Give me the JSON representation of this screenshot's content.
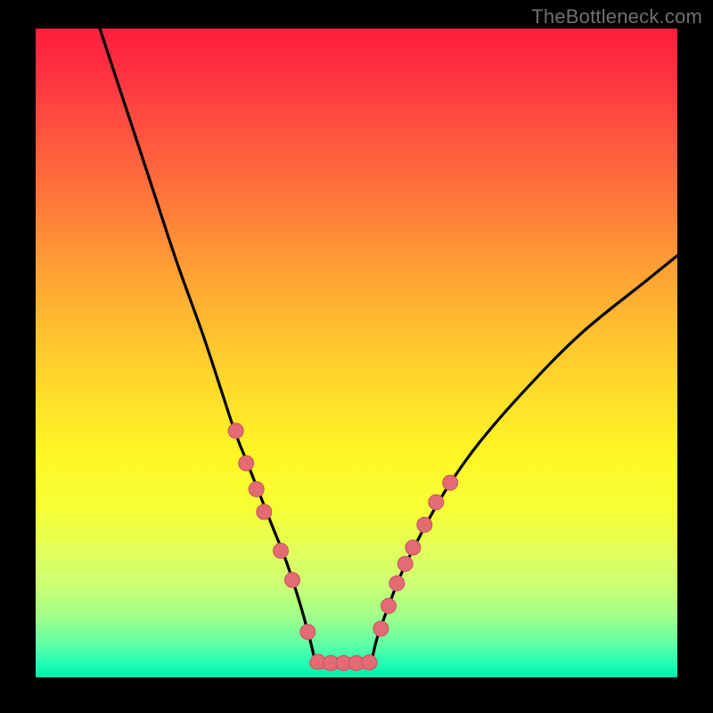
{
  "watermark": {
    "text": "TheBottleneck.com"
  },
  "chart_data": {
    "type": "line",
    "title": "",
    "xlabel": "",
    "ylabel": "",
    "xlim": [
      0,
      100
    ],
    "ylim": [
      0,
      100
    ],
    "series": [
      {
        "name": "left-curve",
        "x": [
          10,
          14,
          18,
          22,
          26,
          29,
          31,
          33,
          35,
          37,
          39,
          41,
          42.7,
          43.6
        ],
        "y": [
          100,
          88,
          76,
          64,
          53,
          44,
          38,
          33,
          28,
          23,
          18,
          12,
          6,
          2.2
        ]
      },
      {
        "name": "right-curve",
        "x": [
          52.3,
          53.2,
          55,
          57,
          60,
          64,
          69,
          76,
          85,
          95,
          100
        ],
        "y": [
          2.2,
          6,
          11,
          16,
          22,
          29,
          36,
          44,
          53,
          61,
          65
        ]
      },
      {
        "name": "flat-bottom",
        "x": [
          43.6,
          52.3
        ],
        "y": [
          2.2,
          2.2
        ]
      }
    ],
    "markers": {
      "name": "highlight-markers",
      "color": "#e46a73",
      "points": [
        {
          "x": 31.2,
          "y": 38.0
        },
        {
          "x": 32.8,
          "y": 33.0
        },
        {
          "x": 34.4,
          "y": 29.0
        },
        {
          "x": 35.6,
          "y": 25.5
        },
        {
          "x": 38.2,
          "y": 19.5
        },
        {
          "x": 40.0,
          "y": 15.0
        },
        {
          "x": 42.4,
          "y": 7.0
        },
        {
          "x": 44.0,
          "y": 2.4
        },
        {
          "x": 46.0,
          "y": 2.2
        },
        {
          "x": 48.0,
          "y": 2.2
        },
        {
          "x": 50.0,
          "y": 2.2
        },
        {
          "x": 52.0,
          "y": 2.3
        },
        {
          "x": 53.8,
          "y": 7.5
        },
        {
          "x": 55.0,
          "y": 11.0
        },
        {
          "x": 56.3,
          "y": 14.5
        },
        {
          "x": 57.6,
          "y": 17.5
        },
        {
          "x": 58.8,
          "y": 20.0
        },
        {
          "x": 60.6,
          "y": 23.5
        },
        {
          "x": 62.4,
          "y": 27.0
        },
        {
          "x": 64.6,
          "y": 30.0
        }
      ]
    },
    "colors": {
      "curve": "#000000",
      "marker_fill": "#e46a73",
      "marker_stroke": "#c2585f",
      "flat_stroke": "#e46a73",
      "background_top": "#ff1e3c",
      "background_bottom": "#00e9a8",
      "frame": "#000000"
    }
  }
}
